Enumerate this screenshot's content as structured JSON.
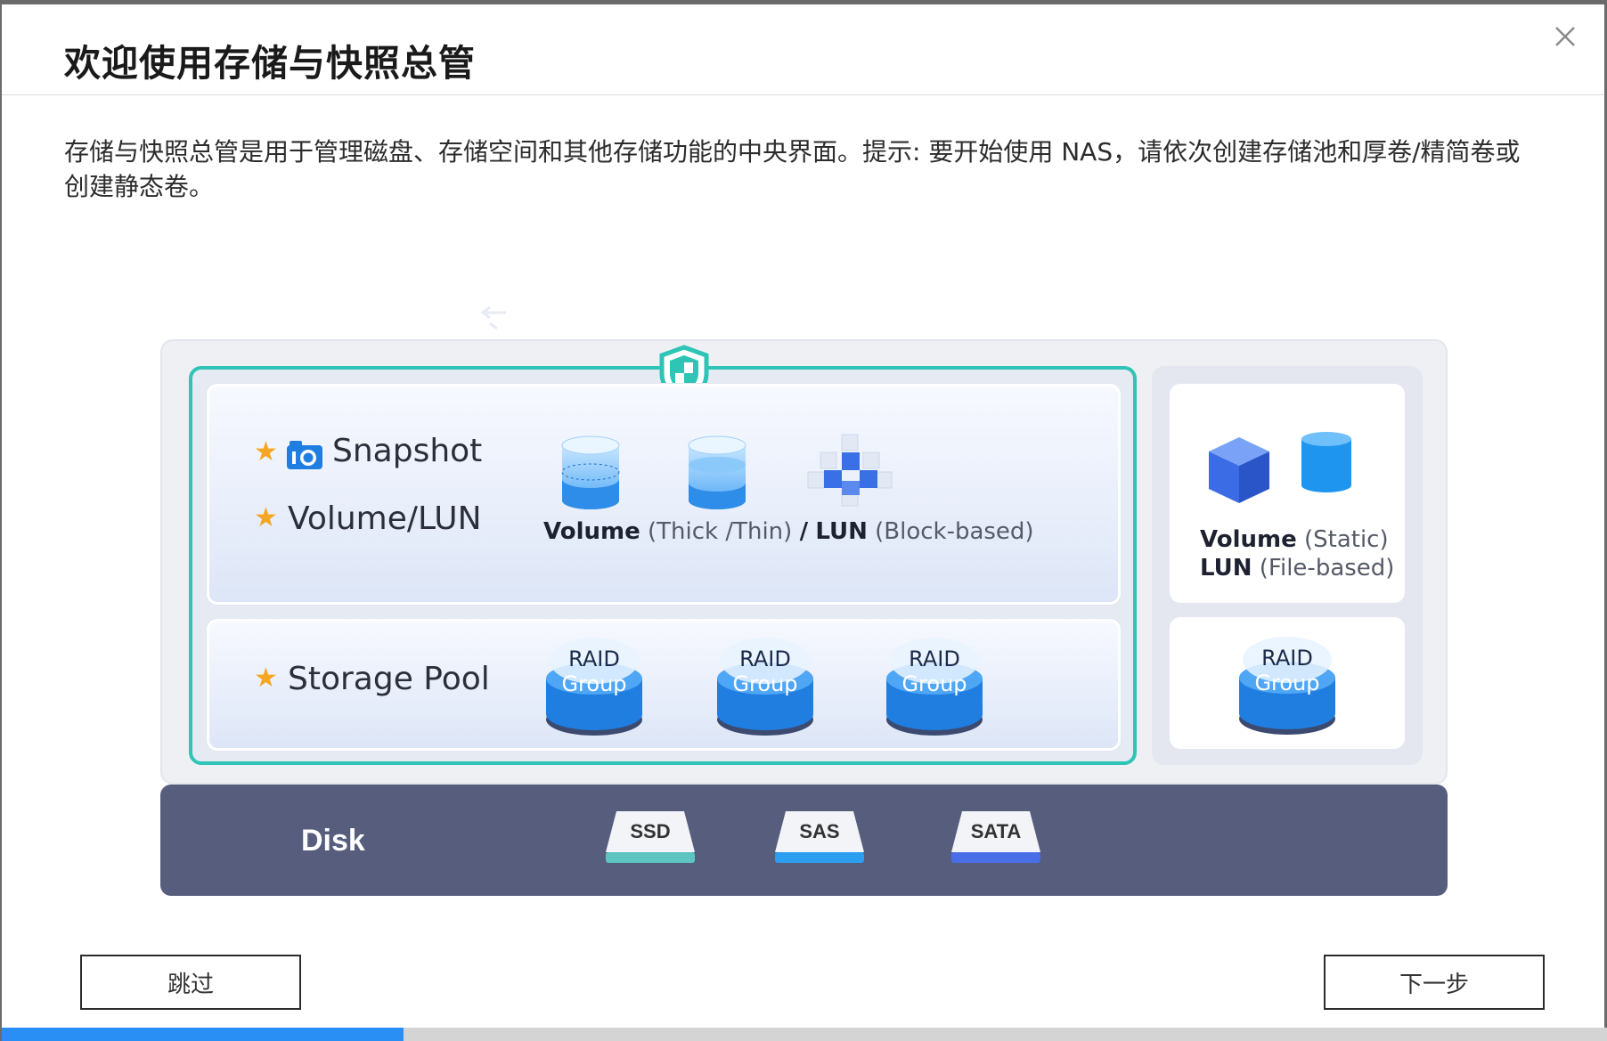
{
  "dialog": {
    "title": "欢迎使用存储与快照总管",
    "description": "存储与快照总管是用于管理磁盘、存储空间和其他存储功能的中央界面。提示: 要开始使用 NAS，请依次创建存储池和厚卷/精简卷或创建静态卷。",
    "close_icon": "close-icon"
  },
  "diagram": {
    "snapshot_label": "Snapshot",
    "volume_lun_label": "Volume/LUN",
    "storage_pool_label": "Storage Pool",
    "volume_bold": "Volume",
    "volume_type": "(Thick /Thin)",
    "lun_sep": "/",
    "lun_bold": "LUN",
    "lun_type": "(Block-based)",
    "static_volume_bold": "Volume",
    "static_volume_type": "(Static)",
    "file_lun_bold": "LUN",
    "file_lun_type": "(File-based)",
    "raid_line1": "RAID",
    "raid_line2": "Group",
    "disk_label": "Disk",
    "drives": [
      "SSD",
      "SAS",
      "SATA"
    ],
    "accent_color": "#2ec4b6",
    "star_color": "#f5a623",
    "disk_bar_color": "#575d7d"
  },
  "footer": {
    "skip_label": "跳过",
    "next_label": "下一步",
    "progress_fraction": 0.25,
    "progress_color": "#2a8ff5"
  }
}
